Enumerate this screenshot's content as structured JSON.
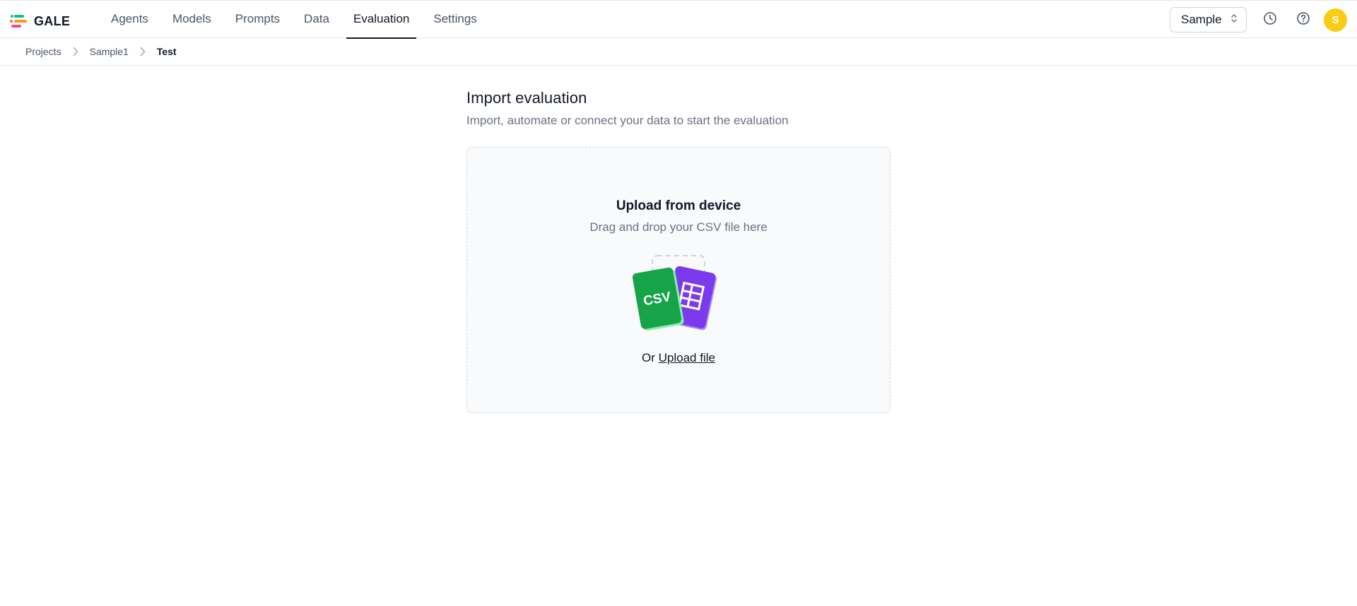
{
  "app": {
    "name": "GALE"
  },
  "nav": {
    "tabs": [
      {
        "label": "Agents",
        "active": false
      },
      {
        "label": "Models",
        "active": false
      },
      {
        "label": "Prompts",
        "active": false
      },
      {
        "label": "Data",
        "active": false
      },
      {
        "label": "Evaluation",
        "active": true
      },
      {
        "label": "Settings",
        "active": false
      }
    ]
  },
  "header": {
    "workspace_selected": "Sample",
    "avatar_initial": "S",
    "icons": [
      "history-icon",
      "help-icon"
    ]
  },
  "breadcrumb": {
    "items": [
      "Projects",
      "Sample1",
      "Test"
    ]
  },
  "page": {
    "title": "Import evaluation",
    "subtitle": "Import, automate or connect your data to start the evaluation"
  },
  "dropzone": {
    "title": "Upload from device",
    "subtitle": "Drag and drop your CSV file here",
    "csv_label": "CSV",
    "or_text": "Or",
    "upload_link": "Upload file"
  },
  "colors": {
    "accent": "#111827",
    "csv_green": "#16a34a",
    "sheet_purple": "#7c3aed",
    "avatar_yellow": "#facc15"
  }
}
